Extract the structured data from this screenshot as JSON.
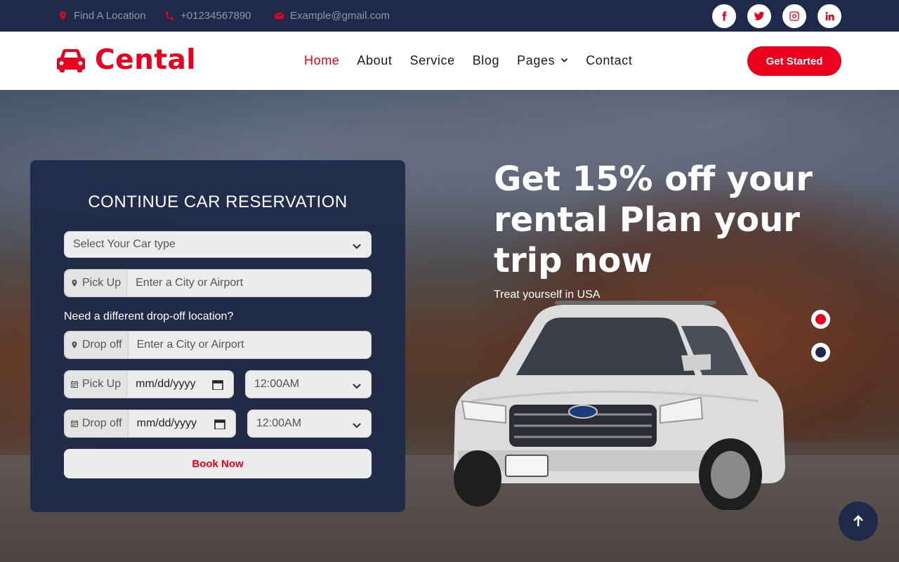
{
  "topbar": {
    "location": "Find A Location",
    "phone": "+01234567890",
    "email": "Example@gmail.com",
    "socials": [
      "facebook-icon",
      "twitter-icon",
      "instagram-icon",
      "linkedin-icon"
    ]
  },
  "brand": {
    "name": "Cental",
    "icon": "car-icon"
  },
  "nav": {
    "items": [
      "Home",
      "About",
      "Service",
      "Blog",
      "Pages",
      "Contact"
    ],
    "active": "Home",
    "cta": "Get Started"
  },
  "reservation": {
    "title": "CONTINUE CAR RESERVATION",
    "car_type_placeholder": "Select Your Car type",
    "pickup_label": "Pick Up",
    "pickup_placeholder": "Enter a City or Airport",
    "dropoff_question": "Need a different drop-off location?",
    "dropoff_label": "Drop off",
    "dropoff_placeholder": "Enter a City or Airport",
    "pickup_date_label": "Pick Up",
    "pickup_date_value": "mm/dd/yyyy",
    "pickup_time_value": "12:00AM",
    "dropoff_date_label": "Drop off",
    "dropoff_date_value": "mm/dd/yyyy",
    "dropoff_time_value": "12:00AM",
    "submit": "Book Now"
  },
  "hero": {
    "headline": "Get 15% off your rental Plan your trip now",
    "subline": "Treat yourself in USA"
  },
  "carousel": {
    "active_index": 0,
    "count": 2
  },
  "colors": {
    "accent": "#ea001e",
    "navy": "#1f2a4a"
  }
}
